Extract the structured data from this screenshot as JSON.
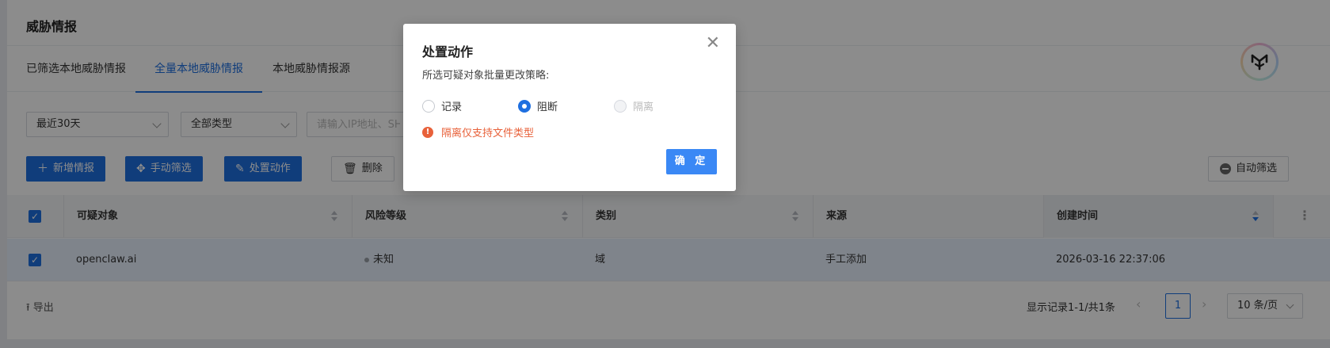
{
  "page": {
    "title": "威胁情报"
  },
  "tabs": [
    {
      "label": "已筛选本地威胁情报"
    },
    {
      "label": "全量本地威胁情报"
    },
    {
      "label": "本地威胁情报源"
    }
  ],
  "filters": {
    "time_select": "最近30天",
    "type_select": "全部类型",
    "search_placeholder": "请输入IP地址、SH"
  },
  "toolbar": {
    "add_label": "新增情报",
    "manual_filter_label": "手动筛选",
    "action_label": "处置动作",
    "delete_label": "删除",
    "auto_filter_label": "自动筛选"
  },
  "table": {
    "columns": [
      "可疑对象",
      "风险等级",
      "类别",
      "来源",
      "创建时间"
    ],
    "rows": [
      {
        "object": "openclaw.ai",
        "risk": "未知",
        "category": "域",
        "source": "手工添加",
        "created": "2026-03-16 22:37:06"
      }
    ]
  },
  "footer": {
    "export_label": "导出",
    "record_info": "显示记录1-1/共1条",
    "current_page": "1",
    "page_size": "10 条/页"
  },
  "modal": {
    "title": "处置动作",
    "description": "所选可疑对象批量更改策略:",
    "options": [
      {
        "label": "记录",
        "state": "unchecked"
      },
      {
        "label": "阻断",
        "state": "checked"
      },
      {
        "label": "隔离",
        "state": "disabled"
      }
    ],
    "warning": "隔离仅支持文件类型",
    "confirm_label": "确 定"
  },
  "colors": {
    "primary": "#1e6fe0",
    "warning": "#e8613a",
    "confirm": "#3a88f5"
  }
}
